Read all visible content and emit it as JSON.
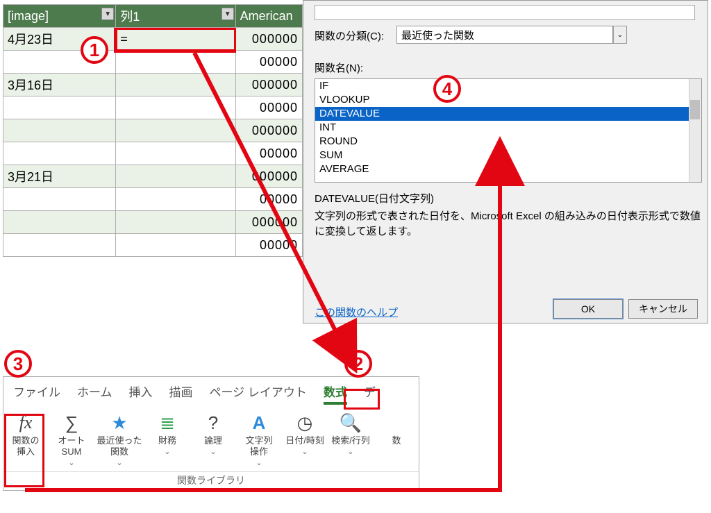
{
  "sheet": {
    "headers": [
      "[image]",
      "列1",
      "American"
    ],
    "rows": [
      {
        "a": "4月23日",
        "b": "=",
        "c": "000000",
        "band": true,
        "editing": true
      },
      {
        "a": "",
        "b": "",
        "c": "00000",
        "band": false
      },
      {
        "a": "3月16日",
        "b": "",
        "c": "000000",
        "band": true
      },
      {
        "a": "",
        "b": "",
        "c": "00000",
        "band": false
      },
      {
        "a": "",
        "b": "",
        "c": "000000",
        "band": true
      },
      {
        "a": "",
        "b": "",
        "c": "00000",
        "band": false
      },
      {
        "a": "3月21日",
        "b": "",
        "c": "000000",
        "band": true
      },
      {
        "a": "",
        "b": "",
        "c": "00000",
        "band": false
      },
      {
        "a": "",
        "b": "",
        "c": "000000",
        "band": true
      },
      {
        "a": "",
        "b": "",
        "c": "00000",
        "band": false
      }
    ]
  },
  "dialog": {
    "category_label": "関数の分類(C):",
    "category_value": "最近使った関数",
    "fn_label": "関数名(N):",
    "functions": [
      "IF",
      "VLOOKUP",
      "DATEVALUE",
      "INT",
      "ROUND",
      "SUM",
      "AVERAGE"
    ],
    "selected_index": 2,
    "syntax": "DATEVALUE(日付文字列)",
    "description": "文字列の形式で表された日付を、Microsoft Excel の組み込みの日付表示形式で数値に変換して返します。",
    "help_link": "この関数のヘルプ",
    "ok": "OK",
    "cancel": "キャンセル"
  },
  "ribbon": {
    "tabs": [
      "ファイル",
      "ホーム",
      "挿入",
      "描画",
      "ページ レイアウト",
      "数式",
      "デ"
    ],
    "active_tab": 5,
    "buttons": [
      {
        "id": "insert-function",
        "icon": "fx",
        "label": "関数の\n挿入"
      },
      {
        "id": "autosum",
        "icon": "∑",
        "label": "オート\nSUM"
      },
      {
        "id": "recent",
        "icon": "★",
        "label": "最近使った\n関数"
      },
      {
        "id": "financial",
        "icon": "≣",
        "label": "財務"
      },
      {
        "id": "logical",
        "icon": "?",
        "label": "論理"
      },
      {
        "id": "text",
        "icon": "A",
        "label": "文字列\n操作"
      },
      {
        "id": "datetime",
        "icon": "◷",
        "label": "日付/時刻"
      },
      {
        "id": "lookup",
        "icon": "🔍",
        "label": "検索/行列"
      },
      {
        "id": "more",
        "icon": "",
        "label": "数"
      }
    ],
    "group_label": "関数ライブラリ"
  },
  "annotations": {
    "1": "1",
    "2": "2",
    "3": "3",
    "4": "4"
  },
  "glyphs": {
    "dropdown": "▼",
    "caret": "⌄"
  }
}
